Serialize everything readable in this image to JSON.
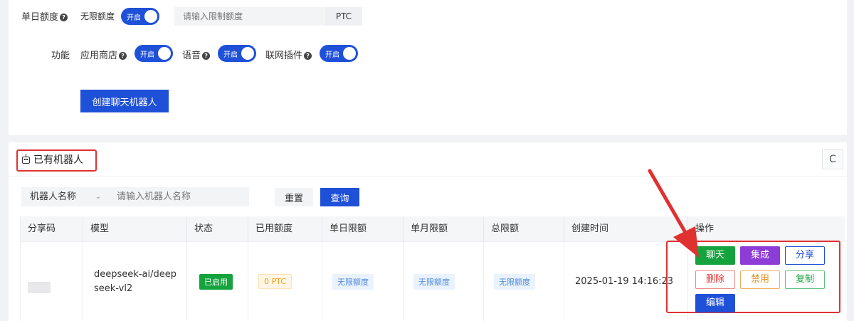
{
  "settings": {
    "daily_limit": {
      "label": "单日额度",
      "unlimited_label": "无限额度",
      "toggle_text": "开启",
      "input_placeholder": "请输入限制额度",
      "unit": "PTC"
    },
    "features": {
      "label": "功能",
      "items": [
        {
          "label": "应用商店",
          "toggle_text": "开启"
        },
        {
          "label": "语音",
          "toggle_text": "开启"
        },
        {
          "label": "联网插件",
          "toggle_text": "开启"
        }
      ]
    },
    "create_button": "创建聊天机器人"
  },
  "list": {
    "title": "已有机器人",
    "refresh_icon": "C",
    "filter": {
      "field_label": "机器人名称",
      "chevron": "⌄",
      "placeholder": "请输入机器人名称",
      "reset_label": "重置",
      "query_label": "查询"
    },
    "columns": [
      "分享码",
      "模型",
      "状态",
      "已用额度",
      "单日限额",
      "单月限额",
      "总限额",
      "创建时间",
      "操作"
    ],
    "rows": [
      {
        "share_code": "",
        "model": "deepseek-ai/deepseek-vl2",
        "status": "已启用",
        "used_quota": "0 PTC",
        "daily_limit": "无限额度",
        "monthly_limit": "无限额度",
        "total_limit": "无限额度",
        "created_at": "2025-01-19 14:16:23",
        "actions": {
          "chat": "聊天",
          "integrate": "集成",
          "share": "分享",
          "delete": "删除",
          "disable": "禁用",
          "copy": "复制",
          "edit": "编辑"
        }
      }
    ]
  },
  "colors": {
    "primary": "#1f50d8",
    "success": "#14a33c",
    "purple": "#8d3dd6",
    "annotation_red": "#e03131"
  }
}
